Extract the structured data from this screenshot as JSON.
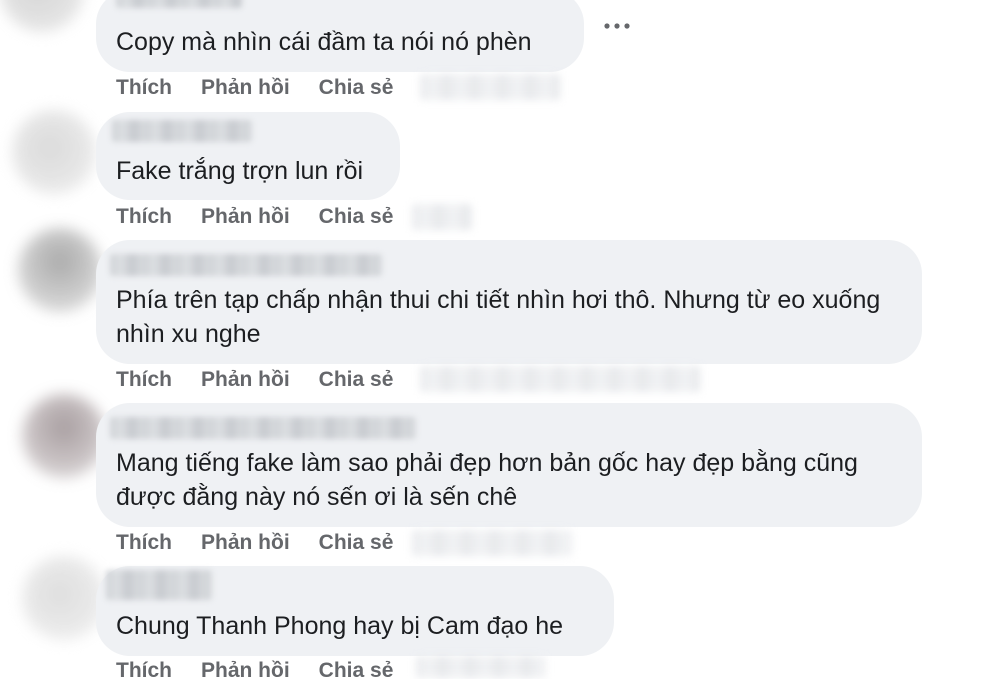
{
  "colors": {
    "bubble_bg": "#eff1f4",
    "text": "#1c1e21",
    "action_text": "#65676b"
  },
  "icons": {
    "more": "more-options-icon"
  },
  "comments": [
    {
      "text": "Copy mà nhìn cái đầm ta nói nó phèn",
      "actions": {
        "like": "Thích",
        "reply": "Phản hồi",
        "share": "Chia sẻ"
      }
    },
    {
      "text": "Fake trắng trợn lun rồi",
      "actions": {
        "like": "Thích",
        "reply": "Phản hồi",
        "share": "Chia sẻ"
      }
    },
    {
      "text": "Phía trên tạp chấp nhận thui chi tiết nhìn hơi thô. Nhưng từ eo xuống nhìn xu nghe",
      "actions": {
        "like": "Thích",
        "reply": "Phản hồi",
        "share": "Chia sẻ"
      }
    },
    {
      "text": "Mang tiếng fake làm sao phải đẹp hơn bản gốc hay đẹp bằng cũng được đằng này nó sến ơi là sến chê",
      "actions": {
        "like": "Thích",
        "reply": "Phản hồi",
        "share": "Chia sẻ"
      }
    },
    {
      "text": "Chung Thanh Phong hay bị Cam đạo he",
      "actions": {
        "like": "Thích",
        "reply": "Phản hồi",
        "share": "Chia sẻ"
      }
    }
  ]
}
